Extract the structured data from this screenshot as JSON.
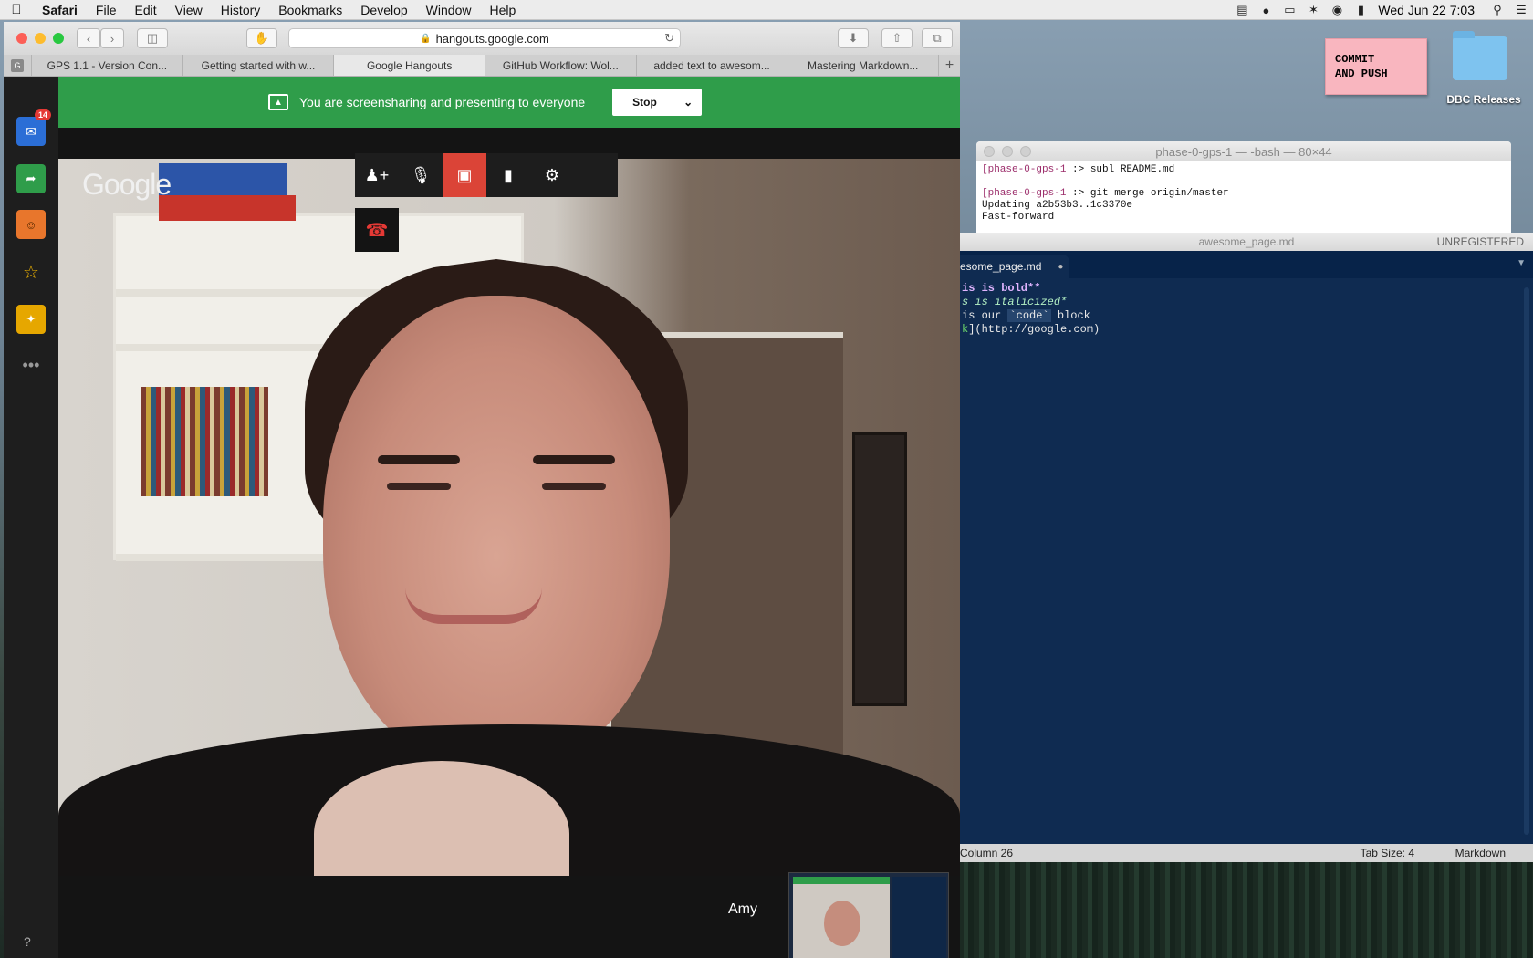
{
  "menubar": {
    "app": "Safari",
    "items": [
      "File",
      "Edit",
      "View",
      "History",
      "Bookmarks",
      "Develop",
      "Window",
      "Help"
    ],
    "clock": "Wed Jun 22  7:03"
  },
  "safari": {
    "url": "hangouts.google.com",
    "tabs": [
      {
        "label": "GPS 1.1 - Version Con..."
      },
      {
        "label": "Getting started with w..."
      },
      {
        "label": "Google Hangouts"
      },
      {
        "label": "GitHub Workflow: Wol..."
      },
      {
        "label": "added text to awesom..."
      },
      {
        "label": "Mastering Markdown..."
      }
    ]
  },
  "hangouts": {
    "badge_count": "14",
    "banner_text": "You are screensharing and presenting to everyone",
    "stop_label": "Stop",
    "google_logo": "Google",
    "participant_name": "Amy",
    "help": "?"
  },
  "terminal": {
    "title": "phase-0-gps-1 — -bash — 80×44",
    "lines": [
      {
        "prompt": "[phase-0-gps-1",
        "cmd": " :> subl README.md"
      },
      {
        "prompt": "",
        "cmd": ""
      },
      {
        "prompt": "[phase-0-gps-1",
        "cmd": " :> git merge origin/master"
      },
      {
        "prompt": "",
        "cmd": "Updating a2b53b3..1c3370e"
      },
      {
        "prompt": "",
        "cmd": "Fast-forward"
      }
    ]
  },
  "sublime": {
    "title": "awesome_page.md",
    "unregistered": "UNREGISTERED",
    "tab": "esome_page.md",
    "code": {
      "line1": "is is bold**",
      "line2": "s is italicized*",
      "line3_pre": " is our ",
      "line3_code": "`code`",
      "line3_post": " block",
      "line4_link": "k",
      "line4_rest": "](http://google.com)"
    },
    "status_col": "Column 26",
    "tab_size": "Tab Size: 4",
    "syntax": "Markdown"
  },
  "desktop": {
    "sticky_line1": "COMMIT",
    "sticky_line2": "AND PUSH",
    "folder_label": "DBC Releases"
  },
  "colors": {
    "banner": "#2f9d4a",
    "video_off": "#db4437",
    "sublime_bg": "#0f2b51",
    "sticky": "#f9b6bf"
  }
}
